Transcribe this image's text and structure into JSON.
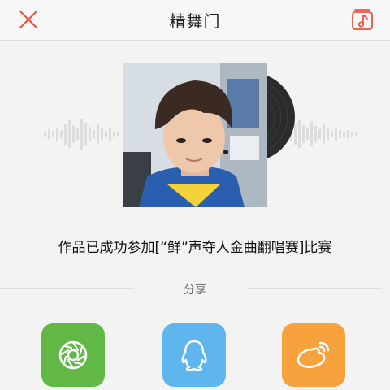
{
  "header": {
    "title": "精舞门",
    "close_icon": "close-icon",
    "music_icon": "music-note-icon"
  },
  "colors": {
    "accent": "#e8533f",
    "moments": "#62b846",
    "qq": "#5fb6ee",
    "weibo": "#f7a23c"
  },
  "player": {
    "cover_icon": "album-cover-photo",
    "disc_icon": "vinyl-disc-icon",
    "waveform_icon": "waveform-icon"
  },
  "message": "作品已成功参加[“鲜”声夺人金曲翻唱赛]比赛",
  "share": {
    "label": "分享",
    "targets": [
      {
        "name": "moments",
        "icon": "camera-shutter-icon"
      },
      {
        "name": "qq",
        "icon": "qq-penguin-icon"
      },
      {
        "name": "weibo",
        "icon": "weibo-icon"
      }
    ]
  }
}
